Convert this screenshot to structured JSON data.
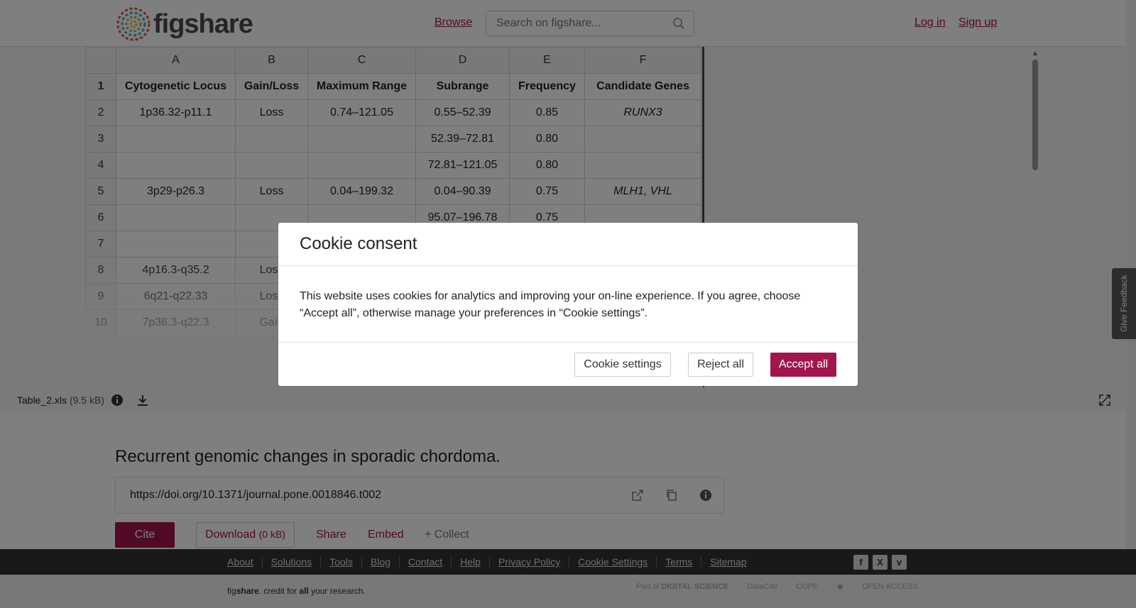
{
  "header": {
    "logo_text": "figshare",
    "browse": "Browse",
    "search_placeholder": "Search on figshare...",
    "login": "Log in",
    "signup": "Sign up"
  },
  "sheet": {
    "columns": [
      "A",
      "B",
      "C",
      "D",
      "E",
      "F"
    ],
    "rows": [
      {
        "n": "1",
        "cells": [
          "Cytogenetic Locus",
          "Gain/Loss",
          "Maximum Range",
          "Subrange",
          "Frequency",
          "Candidate Genes"
        ]
      },
      {
        "n": "2",
        "cells": [
          "1p36.32-p11.1",
          "Loss",
          "0.74–121.05",
          "0.55–52.39",
          "0.85",
          "RUNX3"
        ]
      },
      {
        "n": "3",
        "cells": [
          "",
          "",
          "",
          "52.39–72.81",
          "0.80",
          ""
        ]
      },
      {
        "n": "4",
        "cells": [
          "",
          "",
          "",
          "72.81–121.05",
          "0.80",
          ""
        ]
      },
      {
        "n": "5",
        "cells": [
          "3p29-p26.3",
          "Loss",
          "0.04–199.32",
          "0.04–90.39",
          "0.75",
          "MLH1, VHL"
        ]
      },
      {
        "n": "6",
        "cells": [
          "",
          "",
          "",
          "95.07–196.78",
          "0.75",
          ""
        ]
      },
      {
        "n": "7",
        "cells": [
          "",
          "",
          "",
          "",
          "",
          ""
        ]
      },
      {
        "n": "8",
        "cells": [
          "4p16.3-q35.2",
          "Loss",
          "",
          "",
          "",
          ""
        ]
      },
      {
        "n": "9",
        "cells": [
          "6q21-q22.33",
          "Loss",
          "",
          "",
          "",
          ""
        ]
      },
      {
        "n": "10",
        "cells": [
          "7p36.3-q22.3",
          "Gain",
          "",
          "",
          "",
          ""
        ]
      }
    ]
  },
  "file": {
    "name": "Table_2.xls",
    "size": "(9.5 kB)"
  },
  "item": {
    "title": "Recurrent genomic changes in sporadic chordoma.",
    "doi": "https://doi.org/10.1371/journal.pone.0018846.t002",
    "cite": "Cite",
    "download": "Download",
    "download_size": "(0 kB)",
    "share": "Share",
    "embed": "Embed",
    "collect": "+ Collect"
  },
  "footer": {
    "links": [
      "About",
      "Solutions",
      "Tools",
      "Blog",
      "Contact",
      "Help",
      "Privacy Policy",
      "Cookie Settings",
      "Terms",
      "Sitemap"
    ],
    "tagline_pre": "fig",
    "tagline_bold": "share",
    "tagline_mid": ". credit for ",
    "tagline_all": "all",
    "tagline_end": " your research.",
    "partner_part_of": "Part of",
    "partner_ds": "DIGITAL SCIENCE",
    "partner_datacite": "DataCite",
    "partner_cope": "COPE",
    "partner_openaccess": "OPEN ACCESS"
  },
  "cookie": {
    "title": "Cookie consent",
    "body": "This website uses cookies for analytics and improving your on-line experience. If you agree, choose “Accept all”, otherwise manage your preferences in “Cookie settings”.",
    "settings": "Cookie settings",
    "reject": "Reject all",
    "accept": "Accept all"
  },
  "feedback": "Give Feedback",
  "colors": {
    "brand": "#a3154d"
  }
}
